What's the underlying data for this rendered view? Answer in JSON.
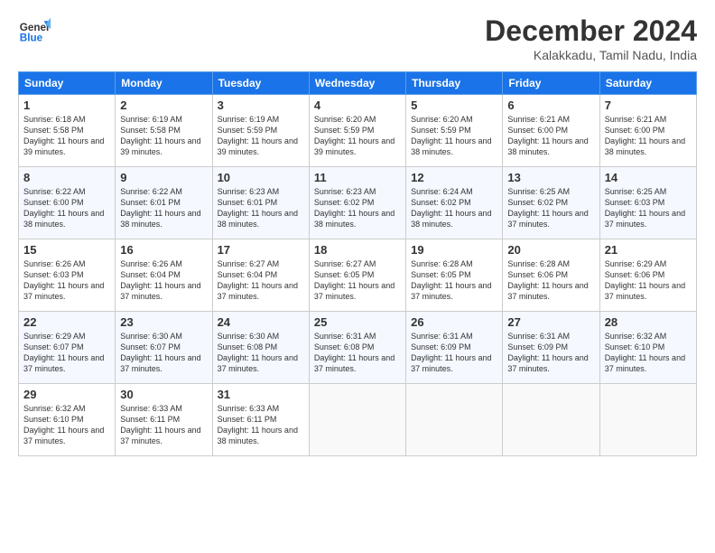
{
  "logo": {
    "line1": "General",
    "line2": "Blue"
  },
  "title": "December 2024",
  "subtitle": "Kalakkadu, Tamil Nadu, India",
  "days_of_week": [
    "Sunday",
    "Monday",
    "Tuesday",
    "Wednesday",
    "Thursday",
    "Friday",
    "Saturday"
  ],
  "weeks": [
    [
      {
        "day": "1",
        "sunrise": "6:18 AM",
        "sunset": "5:58 PM",
        "daylight": "11 hours and 39 minutes."
      },
      {
        "day": "2",
        "sunrise": "6:19 AM",
        "sunset": "5:58 PM",
        "daylight": "11 hours and 39 minutes."
      },
      {
        "day": "3",
        "sunrise": "6:19 AM",
        "sunset": "5:59 PM",
        "daylight": "11 hours and 39 minutes."
      },
      {
        "day": "4",
        "sunrise": "6:20 AM",
        "sunset": "5:59 PM",
        "daylight": "11 hours and 39 minutes."
      },
      {
        "day": "5",
        "sunrise": "6:20 AM",
        "sunset": "5:59 PM",
        "daylight": "11 hours and 38 minutes."
      },
      {
        "day": "6",
        "sunrise": "6:21 AM",
        "sunset": "6:00 PM",
        "daylight": "11 hours and 38 minutes."
      },
      {
        "day": "7",
        "sunrise": "6:21 AM",
        "sunset": "6:00 PM",
        "daylight": "11 hours and 38 minutes."
      }
    ],
    [
      {
        "day": "8",
        "sunrise": "6:22 AM",
        "sunset": "6:00 PM",
        "daylight": "11 hours and 38 minutes."
      },
      {
        "day": "9",
        "sunrise": "6:22 AM",
        "sunset": "6:01 PM",
        "daylight": "11 hours and 38 minutes."
      },
      {
        "day": "10",
        "sunrise": "6:23 AM",
        "sunset": "6:01 PM",
        "daylight": "11 hours and 38 minutes."
      },
      {
        "day": "11",
        "sunrise": "6:23 AM",
        "sunset": "6:02 PM",
        "daylight": "11 hours and 38 minutes."
      },
      {
        "day": "12",
        "sunrise": "6:24 AM",
        "sunset": "6:02 PM",
        "daylight": "11 hours and 38 minutes."
      },
      {
        "day": "13",
        "sunrise": "6:25 AM",
        "sunset": "6:02 PM",
        "daylight": "11 hours and 37 minutes."
      },
      {
        "day": "14",
        "sunrise": "6:25 AM",
        "sunset": "6:03 PM",
        "daylight": "11 hours and 37 minutes."
      }
    ],
    [
      {
        "day": "15",
        "sunrise": "6:26 AM",
        "sunset": "6:03 PM",
        "daylight": "11 hours and 37 minutes."
      },
      {
        "day": "16",
        "sunrise": "6:26 AM",
        "sunset": "6:04 PM",
        "daylight": "11 hours and 37 minutes."
      },
      {
        "day": "17",
        "sunrise": "6:27 AM",
        "sunset": "6:04 PM",
        "daylight": "11 hours and 37 minutes."
      },
      {
        "day": "18",
        "sunrise": "6:27 AM",
        "sunset": "6:05 PM",
        "daylight": "11 hours and 37 minutes."
      },
      {
        "day": "19",
        "sunrise": "6:28 AM",
        "sunset": "6:05 PM",
        "daylight": "11 hours and 37 minutes."
      },
      {
        "day": "20",
        "sunrise": "6:28 AM",
        "sunset": "6:06 PM",
        "daylight": "11 hours and 37 minutes."
      },
      {
        "day": "21",
        "sunrise": "6:29 AM",
        "sunset": "6:06 PM",
        "daylight": "11 hours and 37 minutes."
      }
    ],
    [
      {
        "day": "22",
        "sunrise": "6:29 AM",
        "sunset": "6:07 PM",
        "daylight": "11 hours and 37 minutes."
      },
      {
        "day": "23",
        "sunrise": "6:30 AM",
        "sunset": "6:07 PM",
        "daylight": "11 hours and 37 minutes."
      },
      {
        "day": "24",
        "sunrise": "6:30 AM",
        "sunset": "6:08 PM",
        "daylight": "11 hours and 37 minutes."
      },
      {
        "day": "25",
        "sunrise": "6:31 AM",
        "sunset": "6:08 PM",
        "daylight": "11 hours and 37 minutes."
      },
      {
        "day": "26",
        "sunrise": "6:31 AM",
        "sunset": "6:09 PM",
        "daylight": "11 hours and 37 minutes."
      },
      {
        "day": "27",
        "sunrise": "6:31 AM",
        "sunset": "6:09 PM",
        "daylight": "11 hours and 37 minutes."
      },
      {
        "day": "28",
        "sunrise": "6:32 AM",
        "sunset": "6:10 PM",
        "daylight": "11 hours and 37 minutes."
      }
    ],
    [
      {
        "day": "29",
        "sunrise": "6:32 AM",
        "sunset": "6:10 PM",
        "daylight": "11 hours and 37 minutes."
      },
      {
        "day": "30",
        "sunrise": "6:33 AM",
        "sunset": "6:11 PM",
        "daylight": "11 hours and 37 minutes."
      },
      {
        "day": "31",
        "sunrise": "6:33 AM",
        "sunset": "6:11 PM",
        "daylight": "11 hours and 38 minutes."
      },
      null,
      null,
      null,
      null
    ]
  ]
}
